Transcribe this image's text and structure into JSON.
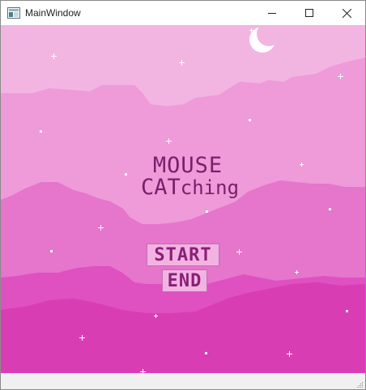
{
  "window": {
    "title": "MainWindow",
    "icon": "app-window-icon",
    "controls": [
      "minimize-icon",
      "maximize-icon",
      "close-icon"
    ]
  },
  "game": {
    "logo_line1": "MOUSE",
    "logo_cat": "CAT",
    "logo_ching": "ching",
    "start_label": "START",
    "end_label": "END"
  },
  "colors": {
    "sky": "#f2b5e2",
    "layer1": "#ef9ad9",
    "layer2": "#e675cc",
    "layer3": "#df50c1",
    "layer4": "#d93db4",
    "text": "#7a1f6b",
    "moon": "#ffffff",
    "star": "#ffffff"
  },
  "icons": {
    "moon": "crescent-moon-icon",
    "stars": "star-icon",
    "resize": "resize-grip-icon"
  }
}
